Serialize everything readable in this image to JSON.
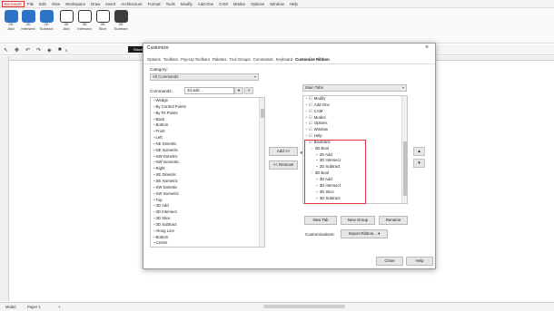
{
  "menubar": [
    "Bonzai3D",
    "File",
    "Edit",
    "View",
    "Workspace",
    "Draw",
    "Insert",
    "Architecture",
    "Format",
    "Tools",
    "Modify",
    "Add-Ons",
    "CAM",
    "Modes",
    "Options",
    "Window",
    "Help"
  ],
  "ribbon": {
    "buttons": [
      {
        "label": "2D\nAdd",
        "icon": "add-2d-icon"
      },
      {
        "label": "2D\nIntersect",
        "icon": "intersect-2d-icon"
      },
      {
        "label": "2D\nSubtract",
        "icon": "subtract-2d-icon"
      },
      {
        "label": "3D\nAdd",
        "icon": "add-3d-icon"
      },
      {
        "label": "3D\nIntersect",
        "icon": "intersect-3d-icon"
      },
      {
        "label": "3D\nSlice",
        "icon": "slice-3d-icon"
      },
      {
        "label": "3D\nSubtract",
        "icon": "subtract-3d-icon"
      }
    ]
  },
  "toolbar2": {
    "layer_label": "Black",
    "layer_num": "0"
  },
  "dialog": {
    "title": "Customize",
    "tabs": [
      "Options",
      "Toolbars",
      "Pop-Up Toolbars",
      "Palettes",
      "Tool Groups",
      "Commands",
      "Keyboard",
      "Customize Ribbon"
    ],
    "active_tab": "Customize Ribbon",
    "category_label": "Category:",
    "category_value": "All Commands",
    "commands_label": "Commands:",
    "commands_search": "3d add",
    "commands_list": [
      "Wedge",
      "By Control Points",
      "By Fit Points",
      "Back",
      "Bottom",
      "Front",
      "Left",
      "NE Dimetric",
      "NE Isometric",
      "NW Dimetric",
      "NW Isometric",
      "Right",
      "SE Dimetric",
      "SE Isometric",
      "SW Dimetric",
      "SW Isometric",
      "Top",
      "3D Add",
      "3D Intersect",
      "3D Slice",
      "3D Subtract",
      "Along Line",
      "Bottom",
      "Center"
    ],
    "tabs_select": "Main Tabs",
    "tree": [
      {
        "text": "Modify",
        "level": 1,
        "prefix": "+ ☑"
      },
      {
        "text": "Add-Ons",
        "level": 1,
        "prefix": "+ ☑"
      },
      {
        "text": "CAM",
        "level": 1,
        "prefix": "+ ☑"
      },
      {
        "text": "Modes",
        "level": 1,
        "prefix": "+ ☑"
      },
      {
        "text": "Options",
        "level": 1,
        "prefix": "+ ☑"
      },
      {
        "text": "Window",
        "level": 1,
        "prefix": "+ ☑"
      },
      {
        "text": "Help",
        "level": 1,
        "prefix": "+ ☑"
      },
      {
        "text": "Booleans",
        "level": 1,
        "prefix": "− ☑"
      },
      {
        "text": "2D Bool",
        "level": 2,
        "prefix": "−"
      },
      {
        "text": "2D Add",
        "level": 3,
        "prefix": "▪"
      },
      {
        "text": "2D Intersect",
        "level": 3,
        "prefix": "▪"
      },
      {
        "text": "2D Subtract",
        "level": 3,
        "prefix": "▪"
      },
      {
        "text": "3D Bool",
        "level": 2,
        "prefix": "−"
      },
      {
        "text": "3D Add",
        "level": 3,
        "prefix": "▪"
      },
      {
        "text": "3D Intersect",
        "level": 3,
        "prefix": "▪"
      },
      {
        "text": "3D Slice",
        "level": 3,
        "prefix": "▪"
      },
      {
        "text": "3D Subtract",
        "level": 3,
        "prefix": "▪"
      }
    ],
    "add_button": "Add >>",
    "remove_button": "<< Remove",
    "new_tab_button": "New Tab",
    "new_group_button": "New Group",
    "rename_button": "Rename",
    "customizations_label": "Customizations:",
    "import_button": "Import Ribbon...",
    "close_button": "Close",
    "help_button": "Help"
  },
  "bottom_tabs": [
    "Model",
    "Paper 1",
    "+"
  ],
  "colors": {
    "accent": "#2f73c8",
    "highlight": "#d9363e"
  }
}
